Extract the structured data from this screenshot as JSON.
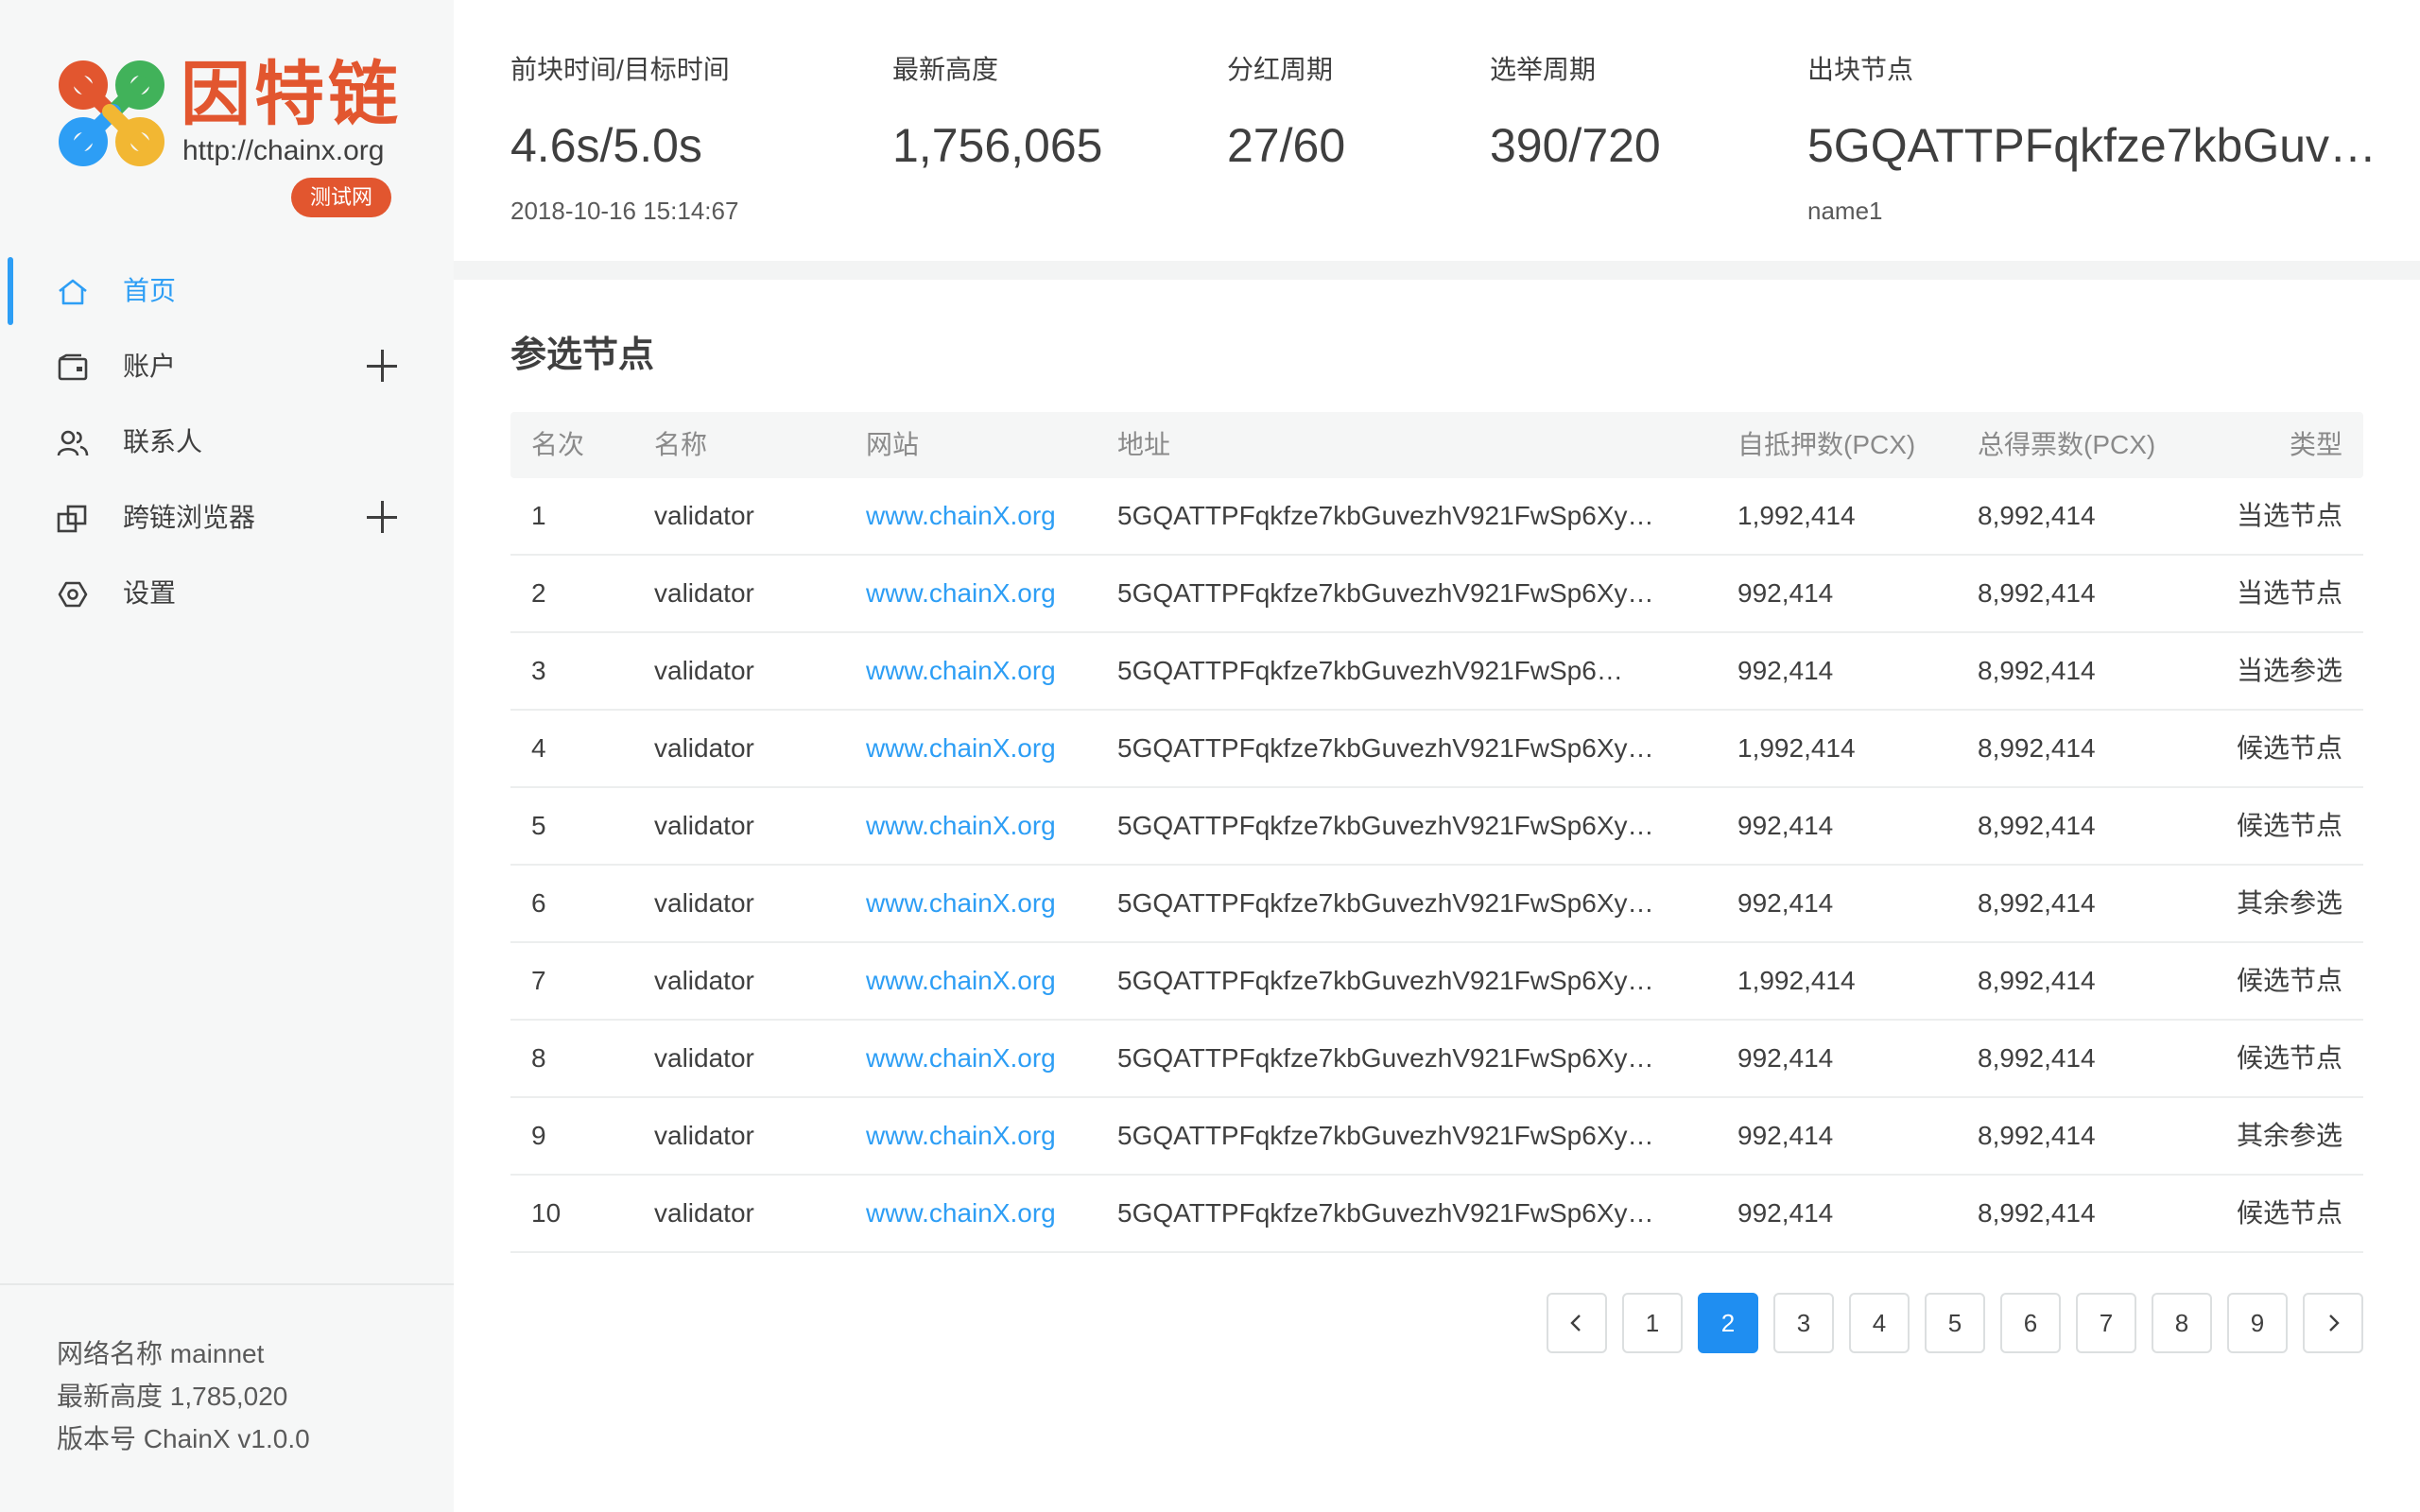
{
  "brand": {
    "name_cn": "因特链",
    "url": "http://chainx.org",
    "badge": "测试网",
    "colors": {
      "orange": "#e2562f",
      "blue": "#2d9ef5",
      "green": "#41b25a",
      "yellow": "#f2b733"
    }
  },
  "nav": {
    "items": [
      {
        "label": "首页",
        "icon": "home-icon",
        "active": true,
        "expandable": false
      },
      {
        "label": "账户",
        "icon": "wallet-icon",
        "active": false,
        "expandable": true
      },
      {
        "label": "联系人",
        "icon": "contacts-icon",
        "active": false,
        "expandable": false
      },
      {
        "label": "跨链浏览器",
        "icon": "cross-chain-icon",
        "active": false,
        "expandable": true
      },
      {
        "label": "设置",
        "icon": "settings-icon",
        "active": false,
        "expandable": false
      }
    ]
  },
  "network": {
    "name_line": "网络名称 mainnet",
    "height_line": "最新高度 1,785,020",
    "version_line": "版本号 ChainX v1.0.0"
  },
  "stats": {
    "block_time": {
      "label": "前块时间/目标时间",
      "value": "4.6s/5.0s",
      "sub": "2018-10-16 15:14:67"
    },
    "height": {
      "label": "最新高度",
      "value": "1,756,065"
    },
    "dividend": {
      "label": "分红周期",
      "value": "27/60"
    },
    "election": {
      "label": "选举周期",
      "value": "390/720"
    },
    "producer": {
      "label": "出块节点",
      "value": "5GQATTPFqkfze7kbGuv…",
      "sub": "name1"
    }
  },
  "candidates": {
    "title": "参选节点",
    "columns": {
      "rank": "名次",
      "name": "名称",
      "site": "网站",
      "address": "地址",
      "pledge": "自抵押数(PCX)",
      "votes": "总得票数(PCX)",
      "type": "类型"
    },
    "rows": [
      {
        "rank": "1",
        "name": "validator",
        "site": "www.chainX.org",
        "address": "5GQATTPFqkfze7kbGuvezhV921FwSp6Xy…",
        "pledge": "1,992,414",
        "votes": "8,992,414",
        "type": "当选节点"
      },
      {
        "rank": "2",
        "name": "validator",
        "site": "www.chainX.org",
        "address": "5GQATTPFqkfze7kbGuvezhV921FwSp6Xy…",
        "pledge": "992,414",
        "votes": "8,992,414",
        "type": "当选节点"
      },
      {
        "rank": "3",
        "name": "validator",
        "site": "www.chainX.org",
        "address": "5GQATTPFqkfze7kbGuvezhV921FwSp6…",
        "pledge": "992,414",
        "votes": "8,992,414",
        "type": "当选参选"
      },
      {
        "rank": "4",
        "name": "validator",
        "site": "www.chainX.org",
        "address": "5GQATTPFqkfze7kbGuvezhV921FwSp6Xy…",
        "pledge": "1,992,414",
        "votes": "8,992,414",
        "type": "候选节点"
      },
      {
        "rank": "5",
        "name": "validator",
        "site": "www.chainX.org",
        "address": "5GQATTPFqkfze7kbGuvezhV921FwSp6Xy…",
        "pledge": "992,414",
        "votes": "8,992,414",
        "type": "候选节点"
      },
      {
        "rank": "6",
        "name": "validator",
        "site": "www.chainX.org",
        "address": "5GQATTPFqkfze7kbGuvezhV921FwSp6Xy…",
        "pledge": "992,414",
        "votes": "8,992,414",
        "type": "其余参选"
      },
      {
        "rank": "7",
        "name": "validator",
        "site": "www.chainX.org",
        "address": "5GQATTPFqkfze7kbGuvezhV921FwSp6Xy…",
        "pledge": "1,992,414",
        "votes": "8,992,414",
        "type": "候选节点"
      },
      {
        "rank": "8",
        "name": "validator",
        "site": "www.chainX.org",
        "address": "5GQATTPFqkfze7kbGuvezhV921FwSp6Xy…",
        "pledge": "992,414",
        "votes": "8,992,414",
        "type": "候选节点"
      },
      {
        "rank": "9",
        "name": "validator",
        "site": "www.chainX.org",
        "address": "5GQATTPFqkfze7kbGuvezhV921FwSp6Xy…",
        "pledge": "992,414",
        "votes": "8,992,414",
        "type": "其余参选"
      },
      {
        "rank": "10",
        "name": "validator",
        "site": "www.chainX.org",
        "address": "5GQATTPFqkfze7kbGuvezhV921FwSp6Xy…",
        "pledge": "992,414",
        "votes": "8,992,414",
        "type": "候选节点"
      }
    ]
  },
  "pagination": {
    "pages": [
      "1",
      "2",
      "3",
      "4",
      "5",
      "6",
      "7",
      "8",
      "9"
    ],
    "current": "2",
    "prev_icon": "chevron-left-icon",
    "next_icon": "chevron-right-icon"
  }
}
